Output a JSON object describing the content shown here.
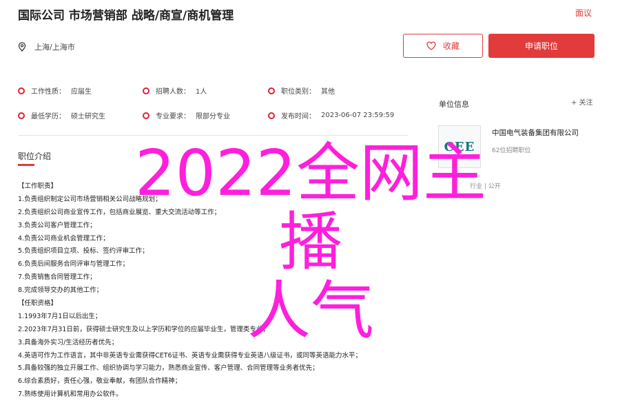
{
  "header": {
    "title": "国际公司 市场营销部 战略/商宣/商机管理",
    "report_label": "面议",
    "location": "上海/上海市",
    "fav_label": "收藏",
    "apply_label": "申请职位"
  },
  "info": {
    "work_type": {
      "label": "工作性质：",
      "value": "应届生"
    },
    "headcount": {
      "label": "招聘人数：",
      "value": "1人"
    },
    "category": {
      "label": "职位类别：",
      "value": "其他"
    },
    "education": {
      "label": "最低学历：",
      "value": "硕士研究生"
    },
    "major": {
      "label": "专业要求：",
      "value": "限部分专业"
    },
    "publish": {
      "label": "发布时间：",
      "value": "2023-06-07 23:59:59"
    }
  },
  "description": {
    "title": "职位介绍",
    "lines": [
      "【工作职责】",
      "1.负责组织制定公司市场营销相关公司战略规划；",
      "2.负责组织公司商业宣传工作，包括商业展览、重大交流活动等工作；",
      "3.负责公司客户管理工作；",
      "4.负责公司商业机会管理工作；",
      "5.负责组织项目立项、投标、签约评审工作；",
      "6.负责后间服务合同评审与管理工作；",
      "7.负责销售合同管理工作；",
      "8.完成领导交办的其他工作；",
      "【任职资格】",
      "1.1993年7月1日以后出生；",
      "2.2023年7月31日前，获得硕士研究生及以上学历和学位的应届毕业生，管理类专业；",
      "3.具备海外实习/生活经历者优先；",
      "4.英语可作为工作语言，其中非英语专业需获得CET6证书、英语专业需获得专业英语八级证书，或同等英语能力水平；",
      "5.具备较强的独立开展工作、组织协调与学习能力，熟悉商业宣传、客户管理、合同管理等业务者优先；",
      "6.综合素质好，责任心强，敬业奉献，有团队合作精神；",
      "7.熟练使用计算机和常用办公软件。"
    ]
  },
  "sidebar": {
    "title": "单位信息",
    "follow_label": "+ 关注",
    "logo_text": "CEE",
    "company_name": "中国电气装备集团有限公司",
    "company_sub": "62位招聘职位",
    "company_tags": "行业 | 公开"
  },
  "overlay": {
    "line1": "2022全网主播",
    "line2": "人气"
  },
  "colors": {
    "accent": "#e23b3b",
    "overlay": "#ff1fdc"
  }
}
